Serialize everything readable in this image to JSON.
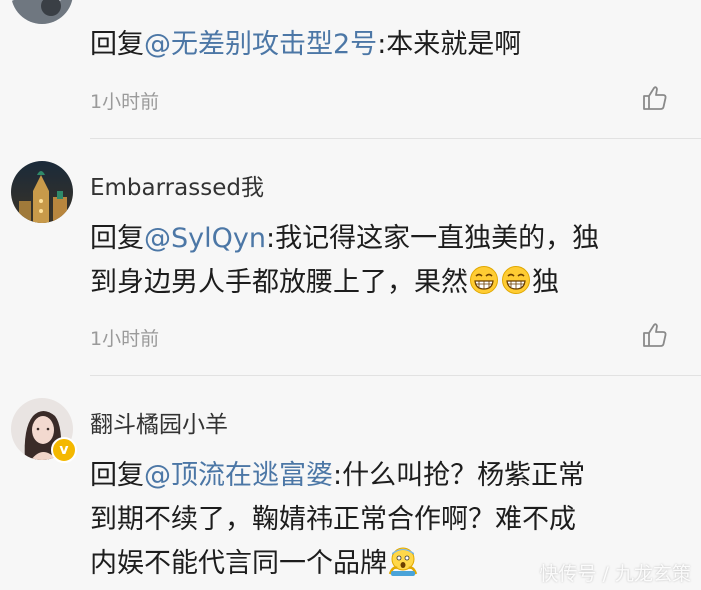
{
  "comments": [
    {
      "username": "",
      "reply_prefix": "回复",
      "mention": "@无差别攻击型2号",
      "text": ":本来就是啊",
      "time": "1小时前"
    },
    {
      "username": "Embarrassed我",
      "reply_prefix": "回复",
      "mention": "@SylQyn",
      "text_line1": ":我记得这家一直独美的，独",
      "text_line2": "到身边男人手都放腰上了，果然",
      "text_line2_end": "独",
      "time": "1小时前"
    },
    {
      "username": "翻斗橘园小羊",
      "reply_prefix": "回复",
      "mention": "@顶流在逃富婆",
      "text_line1": ":什么叫抢？杨紫正常",
      "text_line2": "到期不续了，鞠婧祎正常合作啊？难不成",
      "text_line3": "内娱不能代言同一个品牌",
      "verified_badge": "v"
    }
  ],
  "watermark": "快传号 / 九龙玄策",
  "icons": {
    "like": "thumbs-up-icon",
    "grin": "grinning-face-icon",
    "shocked": "screaming-face-icon"
  },
  "colors": {
    "mention": "#4c77a6",
    "time": "#9a9a9a",
    "background": "#f7f7f7"
  }
}
